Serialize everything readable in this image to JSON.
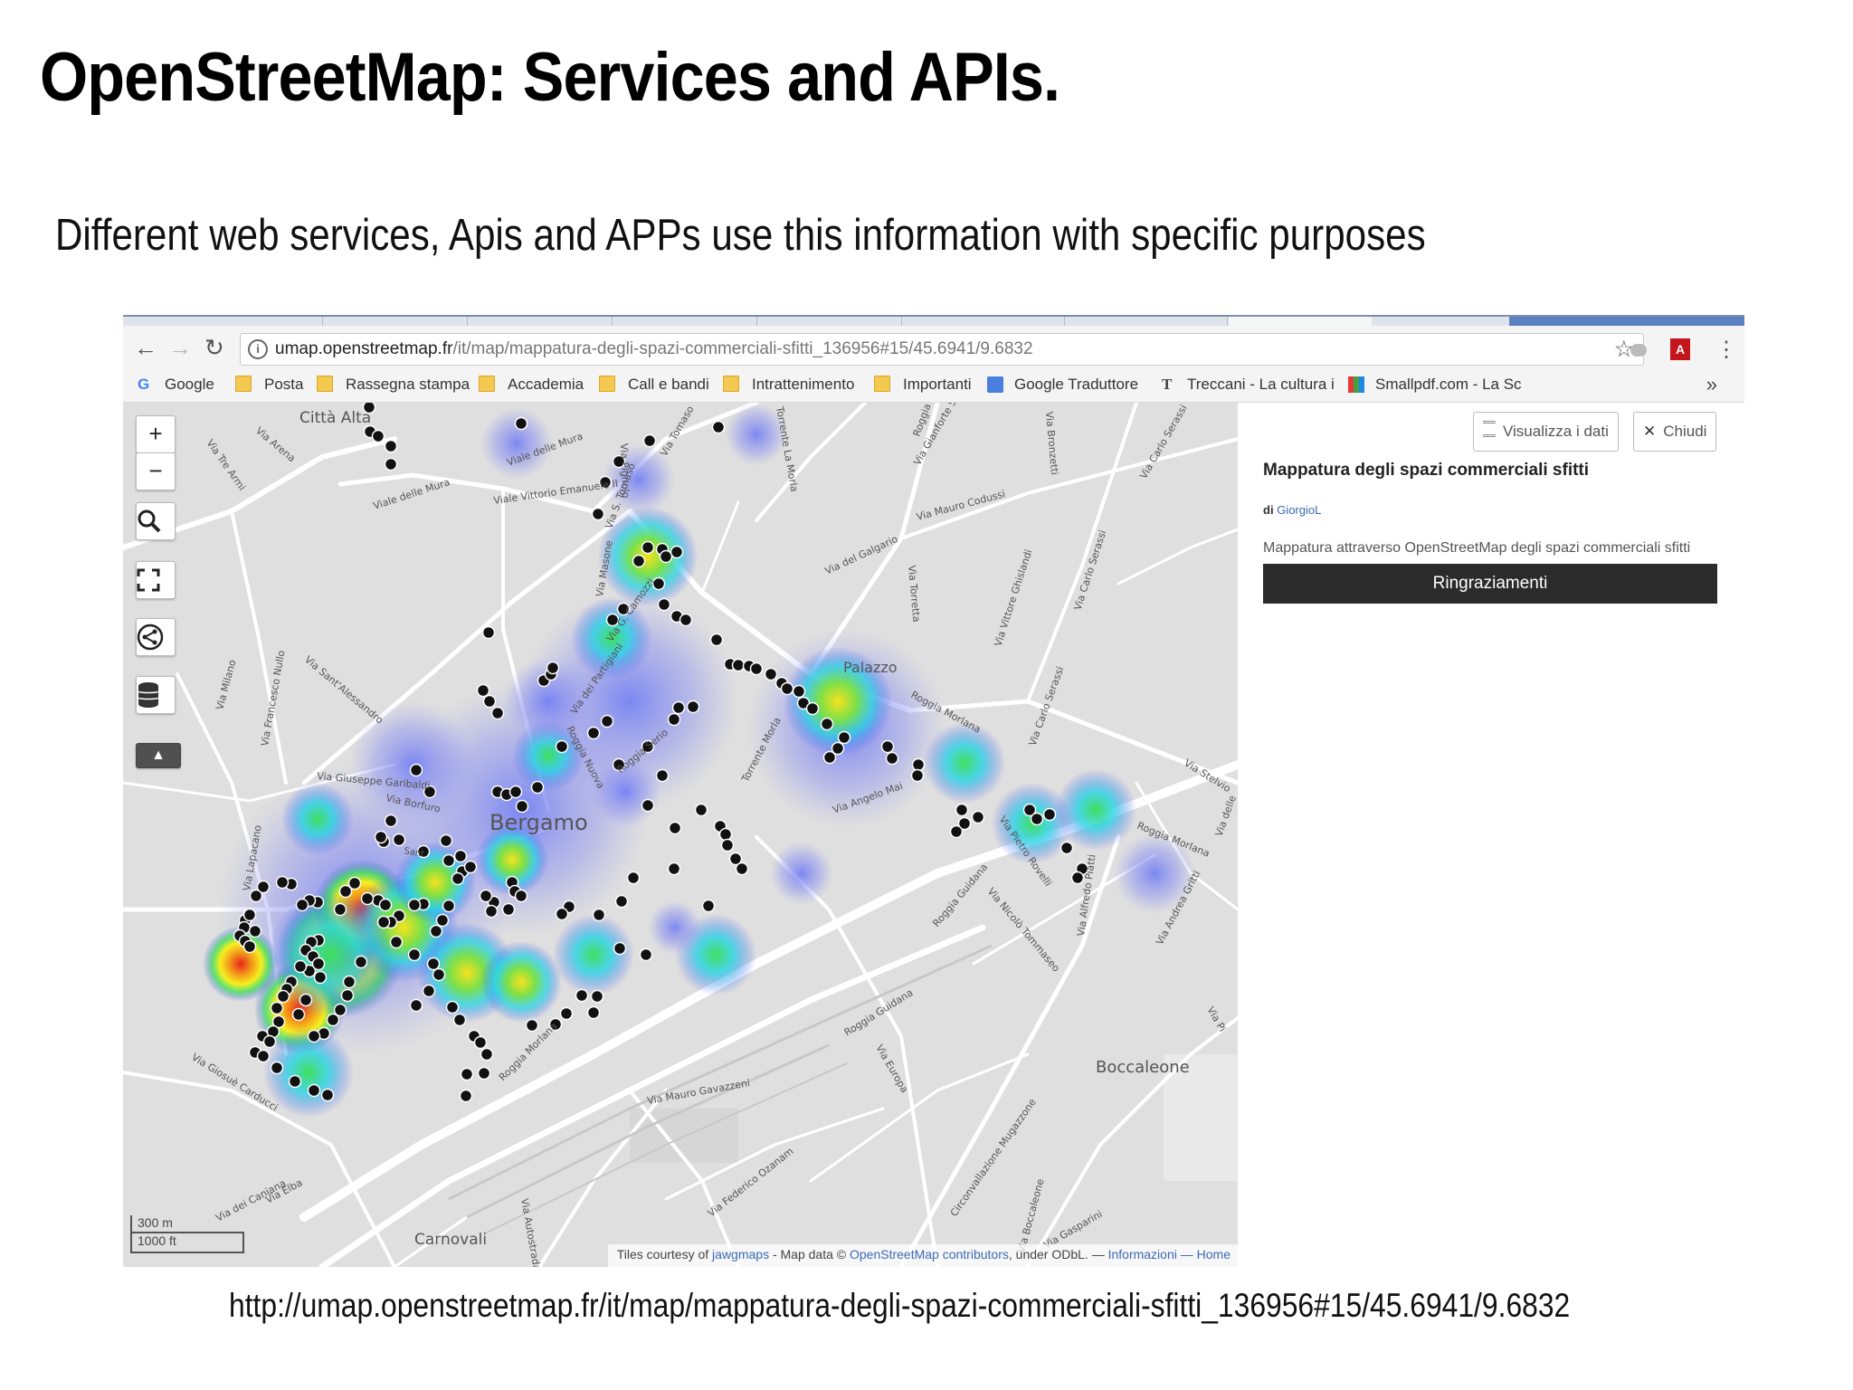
{
  "slide": {
    "title": "OpenStreetMap: Services and APIs.",
    "subtitle": "Different web services, Apis and APPs use this information with specific purposes",
    "footer_url": "http://umap.openstreetmap.fr/it/map/mappatura-degli-spazi-commerciali-sfitti_136956#15/45.6941/9.6832"
  },
  "browser": {
    "address_host": "umap.openstreetmap.fr",
    "address_path": "/it/map/mappatura-degli-spazi-commerciali-sfitti_136956#15/45.6941/9.6832",
    "bookmarks": [
      "Google",
      "Posta",
      "Rassegna stampa",
      "Accademia",
      "Call e bandi",
      "Intrattenimento",
      "Importanti",
      "Google Traduttore",
      "Treccani - La cultura i",
      "Smallpdf.com - La Sc"
    ],
    "more_label": "»"
  },
  "map": {
    "controls": {
      "zoom_in": "+",
      "zoom_out": "−"
    },
    "scale": {
      "meters": "300 m",
      "feet": "1000 ft"
    },
    "attribution": {
      "prefix": "Tiles courtesy of ",
      "jawgmaps": "jawgmaps",
      "mid": " - Map data © ",
      "osm": "OpenStreetMap contributors",
      "license": ", under ODbL. — ",
      "info": "Informazioni",
      "sep": " — ",
      "home": "Home"
    },
    "labels": {
      "city": "Bergamo",
      "citta_alta": "Città Alta",
      "boccaleone": "Boccaleone",
      "carnovali": "Carnovali",
      "palazzo": "Palazzo",
      "via_arena": "Via Arena",
      "via_tre_armi": "Via Tre Armi",
      "viale_delle_mura": "Viale delle Mura",
      "viale_delle_mura_2": "Viale delle Mura",
      "viale_vittorio_emanuele": "Viale Vittorio Emanuele II",
      "via_pignolo": "Via Pignolo",
      "via_tomaso": "Via Tomaso",
      "via_masone": "Via Masone",
      "via_san_tomaso": "Via S. Tomaso",
      "via_camozzi": "Via G. Camozzi",
      "via_dei_partigiani": "Via dei Partigiani",
      "roggia_nuova": "Roggia Nuova",
      "roggia_serio": "Roggia Serio",
      "torrente_morla": "Torrente Morla",
      "roggia_morlana": "Roggia Morlana",
      "roggia_morlana_2": "Roggia Morlana",
      "roggia_morlana_3": "Roggia Morlana",
      "roggia_guidana": "Roggia Guidana",
      "roggia_guidana_2": "Roggia Guidana",
      "via_angelo_mai": "Via Angelo Mai",
      "via_giuseppe_garibaldi": "Via Giuseppe Garibaldi",
      "via_borfuro": "Via Borfuro",
      "via_sant_alessandro": "Via Sant'Alessandro",
      "via_francesco_nullo": "Via Francesco Nullo",
      "via_milano": "Via Milano",
      "via_lapacano": "Via Lapacano",
      "via_giosue_carducci": "Via Giosuè Carducci",
      "via_dei_caniana": "Via dei Caniana",
      "via_elba": "Via Elba",
      "via_autostrada": "Via Autostrada",
      "via_mauro_gavazzeni": "Via Mauro Gavazzeni",
      "via_federico_ozanam": "Via Federico Ozanam",
      "via_europa": "Via Europa",
      "circonvallazione_mugazzone": "Circonvallazione Mugazzone",
      "via_boccaleone": "Via Boccaleone",
      "via_gasparini": "Via Gasparini",
      "via_del_galgario": "Via del Galgario",
      "via_torretta": "Via Torretta",
      "via_vittore_ghislandi": "Via Vittore Ghislandi",
      "via_carlo_serassi": "Via Carlo Serassi",
      "via_carlo_serassi_2": "Via Carlo Serassi",
      "via_carlo_serassi_3": "Via Carlo Serassi",
      "via_mauro_codussi": "Via Mauro Codussi",
      "via_gianforte_suardi": "Via Gianforte Suardi",
      "roggia": "Roggia",
      "via_bronzetti": "Via Bronzetti",
      "torrente_la_morla": "Torrente La Morla",
      "via_pietro_rovelli": "Via Pietro Rovelli",
      "via_nicolo_tommaseo": "Via Nicolò Tommaseo",
      "via_alfredo_piatti": "Via Alfredo Piatti",
      "via_andrea_gritti": "Via Andrea Gritti",
      "via_stelvio": "Via Stelvio",
      "via_delle": "Via delle",
      "via_pi": "Via Pi",
      "sant": "Sant"
    }
  },
  "panel": {
    "view_data_button": "Visualizza i dati",
    "close_button": "Chiudi",
    "title": "Mappatura degli spazi commerciali sfitti",
    "author_prefix": "di",
    "author": "GiorgioL",
    "description": "Mappatura attraverso OpenStreetMap degli spazi commerciali sfitti",
    "thanks_button": "Ringraziamenti"
  },
  "colors": {
    "heat_red": "#e8251c",
    "heat_yellow": "#f6f01e",
    "heat_green": "#3fe05a",
    "heat_cyan": "#26d3e6",
    "heat_blue": "#4f5bf0",
    "marker": "#111111",
    "panel_button": "#2b2b2b",
    "link_blue": "#3b6ab5"
  }
}
